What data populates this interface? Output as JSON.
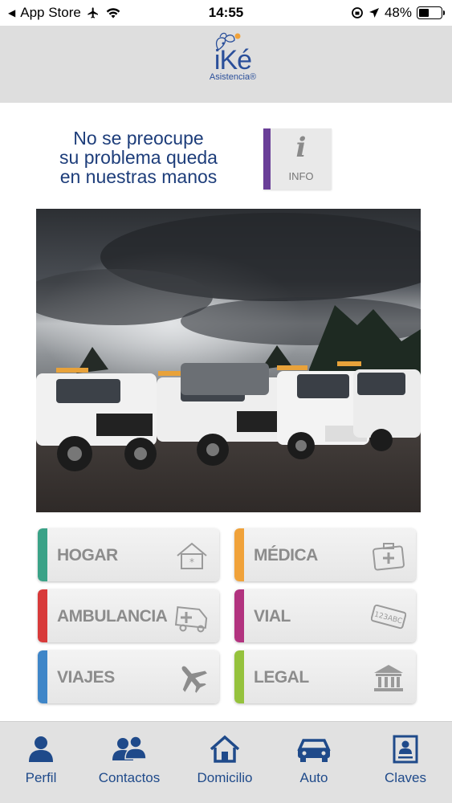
{
  "status_bar": {
    "back_app": "App Store",
    "time": "14:55",
    "battery": "48%",
    "battery_level": 0.48
  },
  "header": {
    "logo_main": "iKé",
    "logo_sub": "Asistencia®"
  },
  "tagline": {
    "line1": "No se preocupe",
    "line2": "su problema queda",
    "line3": "en nuestras manos"
  },
  "info_button": {
    "glyph": "i",
    "label": "INFO",
    "accent": "#6a3f98"
  },
  "services": [
    {
      "label": "HOGAR",
      "color": "#3aa287",
      "icon": "house-icon"
    },
    {
      "label": "MÉDICA",
      "color": "#f0a23a",
      "icon": "first-aid-kit-icon"
    },
    {
      "label": "AMBULANCIA",
      "color": "#d83a3a",
      "icon": "ambulance-icon"
    },
    {
      "label": "VIAL",
      "color": "#b2337f",
      "icon": "license-plate-icon",
      "icon_text": "123ABC"
    },
    {
      "label": "VIAJES",
      "color": "#3f86c8",
      "icon": "airplane-icon"
    },
    {
      "label": "LEGAL",
      "color": "#95c23d",
      "icon": "courthouse-icon"
    }
  ],
  "tabs": [
    {
      "label": "Perfil",
      "icon": "person-icon"
    },
    {
      "label": "Contactos",
      "icon": "people-icon"
    },
    {
      "label": "Domicilio",
      "icon": "house-icon"
    },
    {
      "label": "Auto",
      "icon": "car-icon"
    },
    {
      "label": "Claves",
      "icon": "id-card-icon"
    }
  ],
  "colors": {
    "brand_blue": "#1f4a8a",
    "header_bg": "#dedede"
  }
}
